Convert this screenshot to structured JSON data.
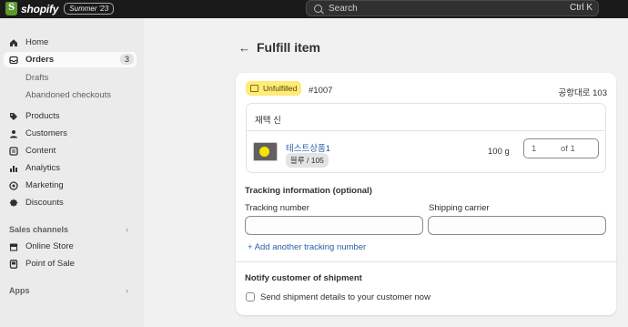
{
  "topbar": {
    "logo_text": "shopify",
    "edition": "Summer '23",
    "search_placeholder": "Search",
    "shortcut": "Ctrl K"
  },
  "sidebar": {
    "home": "Home",
    "orders": "Orders",
    "orders_count": "3",
    "drafts": "Drafts",
    "abandoned": "Abandoned checkouts",
    "products": "Products",
    "customers": "Customers",
    "content": "Content",
    "analytics": "Analytics",
    "marketing": "Marketing",
    "discounts": "Discounts",
    "sales_channels": "Sales channels",
    "online_store": "Online Store",
    "point_of_sale": "Point of Sale",
    "apps": "Apps"
  },
  "page": {
    "title": "Fulfill item"
  },
  "fulfillment": {
    "status_badge": "Unfulfilled",
    "order_number": "#1007",
    "location": "공항대로 103",
    "group_header": "재택 신",
    "product_name": "테스트상품1",
    "variant": "블루 / 105",
    "weight": "100 g",
    "quantity": "1",
    "quantity_of": "of 1"
  },
  "tracking": {
    "title": "Tracking information (optional)",
    "number_label": "Tracking number",
    "number_value": "",
    "carrier_label": "Shipping carrier",
    "carrier_value": "",
    "add_link": "+ Add another tracking number"
  },
  "notify": {
    "title": "Notify customer of shipment",
    "checkbox_label": "Send shipment details to your customer now",
    "checked": false
  }
}
